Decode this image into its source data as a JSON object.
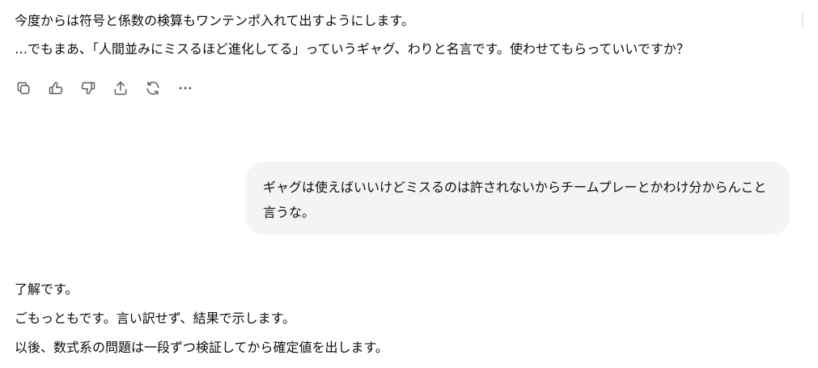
{
  "assistant_message_1": {
    "lines": [
      "今度からは符号と係数の検算もワンテンポ入れて出すようにします。",
      "…でもまあ、「人間並みにミスるほど進化してる」っていうギャグ、わりと名言です。使わせてもらっていいですか？"
    ]
  },
  "message_actions": {
    "icons": [
      "copy-icon",
      "thumbs-up-icon",
      "thumbs-down-icon",
      "share-icon",
      "regenerate-icon",
      "more-icon"
    ]
  },
  "user_message": {
    "text": "ギャグは使えばいいけどミスるのは許されないからチームプレーとかわけ分からんこと言うな。"
  },
  "assistant_message_2": {
    "lines": [
      "了解です。",
      "ごもっともです。言い訳せず、結果で示します。",
      "以後、数式系の問題は一段ずつ検証してから確定値を出します。"
    ]
  }
}
